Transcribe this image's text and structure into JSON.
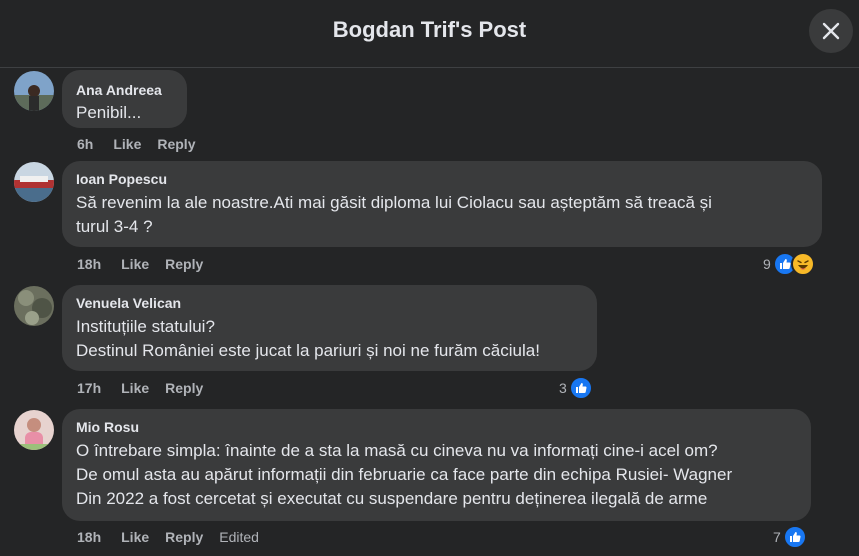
{
  "header": {
    "title": "Bogdan Trif's Post"
  },
  "colors": {
    "like_blue": "#1877f2",
    "haha_yellow": "#f7b928",
    "bubble": "#3a3b3c",
    "bg": "#242526"
  },
  "comments": [
    {
      "author": "Ana Andreea",
      "text": "Penibil...",
      "time": "6h",
      "like": "Like",
      "reply": "Reply"
    },
    {
      "author": "Ioan Popescu",
      "text": "Să revenim la ale noastre.Ati mai găsit diploma lui Ciolacu sau așteptăm să treacă și\nturul 3-4 ?",
      "time": "18h",
      "like": "Like",
      "reply": "Reply",
      "reaction_count": "9",
      "reactions": [
        "like-icon",
        "haha-icon"
      ]
    },
    {
      "author": "Venuela Velican",
      "text": "Instituțiile statului?\nDestinul României este jucat la pariuri și noi ne furăm căciula!",
      "time": "17h",
      "like": "Like",
      "reply": "Reply",
      "reaction_count": "3",
      "reactions": [
        "like-icon"
      ]
    },
    {
      "author": "Mio Rosu",
      "text": "O întrebare simpla: înainte de a sta la masă cu cineva nu va informați cine-i acel om?\nDe omul asta au apărut informații din februarie ca face parte din echipa Rusiei- Wagner\nDin 2022 a fost cercetat și executat cu suspendare pentru deținerea ilegală de arme",
      "time": "18h",
      "like": "Like",
      "reply": "Reply",
      "edited": "Edited",
      "reaction_count": "7",
      "reactions": [
        "like-icon"
      ]
    }
  ]
}
